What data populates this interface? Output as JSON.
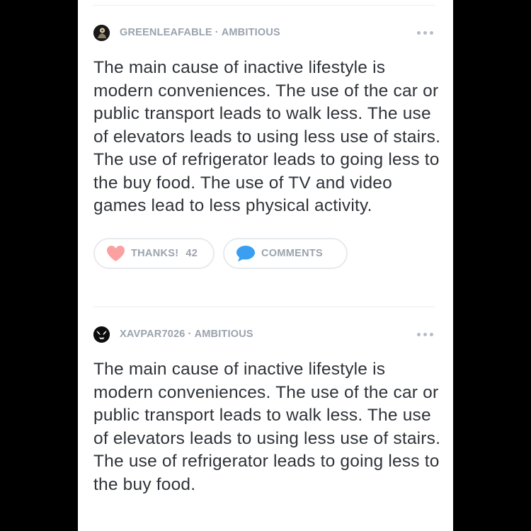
{
  "answers": [
    {
      "username": "GREENLEAFABLE",
      "separator": "·",
      "rank": "AMBITIOUS",
      "avatar_icon": "user-avatar-icon",
      "text": "The main cause of inactive lifestyle is modern conveniences. The use of the car or public transport leads to walk less. The use of elevators leads to using less use of stairs. The use of refrigerator leads to going less to the buy food. The use of TV and video games lead to less physical activity.",
      "thanks_label": "THANKS!",
      "thanks_count": "42",
      "comments_label": "COMMENTS"
    },
    {
      "username": "XAVPAR7026",
      "separator": "·",
      "rank": "AMBITIOUS",
      "avatar_icon": "venom-avatar-icon",
      "text": "The main cause of inactive lifestyle is modern conveniences. The use of the car or public transport leads to walk less. The use of elevators leads to using less use of stairs. The use of refrigerator leads to going less to the buy food."
    }
  ],
  "colors": {
    "heart": "#fba1a1",
    "comment_bubble": "#3a9ff2",
    "meta_text": "#9aa3ad",
    "body_text": "#2f3338"
  },
  "icons": [
    "more-options-icon",
    "heart-icon",
    "comment-bubble-icon"
  ]
}
